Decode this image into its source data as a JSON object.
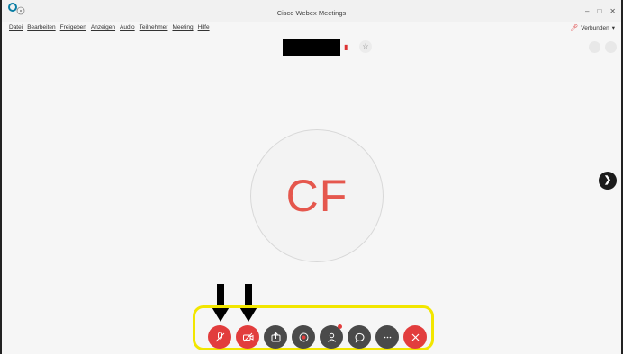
{
  "window": {
    "title": "Cisco Webex Meetings",
    "controls": {
      "minimize": "–",
      "maximize": "□",
      "close": "✕"
    }
  },
  "menu": {
    "items": [
      "Datei",
      "Bearbeiten",
      "Freigeben",
      "Anzeigen",
      "Audio",
      "Teilnehmer",
      "Meeting",
      "Hilfe"
    ]
  },
  "status": {
    "label": "Verbunden",
    "caret": "▾"
  },
  "participant": {
    "initials": "CF"
  },
  "controls": {
    "buttons": [
      "mute",
      "stop-video",
      "share",
      "record",
      "participants",
      "chat",
      "more",
      "leave"
    ]
  },
  "colors": {
    "accent_red": "#e23d3d",
    "initials_red": "#e5574d",
    "dark_button": "#4a4a4a",
    "highlight": "#f2e600"
  },
  "icons": {
    "app": "webex-logo-icon",
    "info": "info-icon",
    "star": "star-icon",
    "next": "chevron-right-icon"
  }
}
